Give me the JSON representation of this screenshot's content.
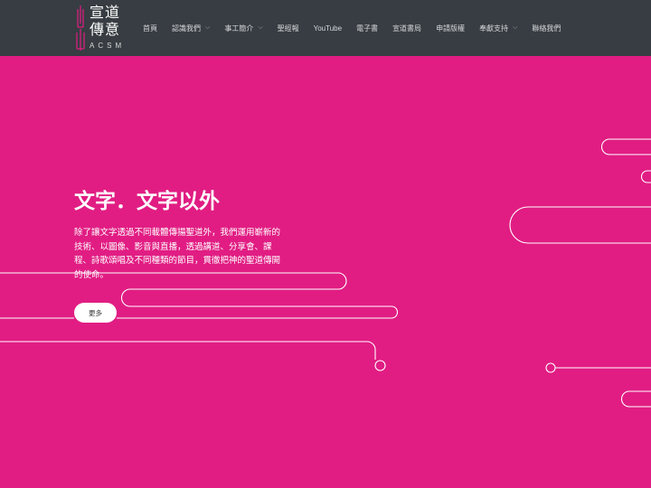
{
  "brand": {
    "line1": "宣道",
    "line2": "傳意",
    "sub": "ACSM"
  },
  "nav": [
    {
      "label": "首頁",
      "dropdown": false
    },
    {
      "label": "認識我們",
      "dropdown": true
    },
    {
      "label": "事工簡介",
      "dropdown": true
    },
    {
      "label": "聖經報",
      "dropdown": false
    },
    {
      "label": "YouTube",
      "dropdown": false
    },
    {
      "label": "電子書",
      "dropdown": false
    },
    {
      "label": "宣道書局",
      "dropdown": false
    },
    {
      "label": "申請版權",
      "dropdown": false
    },
    {
      "label": "奉獻支持",
      "dropdown": true
    },
    {
      "label": "聯絡我們",
      "dropdown": false
    }
  ],
  "hero": {
    "title": "文字．文字以外",
    "body": "除了讓文字透過不同載體傳揚聖道外，我們運用嶄新的技術、以圖像、影音與直播，透過講道、分享會、課程、詩歌頌唱及不同種類的節目，貫徹把神的聖道傳開的使命。",
    "button": "更多"
  },
  "colors": {
    "header_bg": "#373d42",
    "page_bg": "#e11d83",
    "line": "#ffffff"
  }
}
